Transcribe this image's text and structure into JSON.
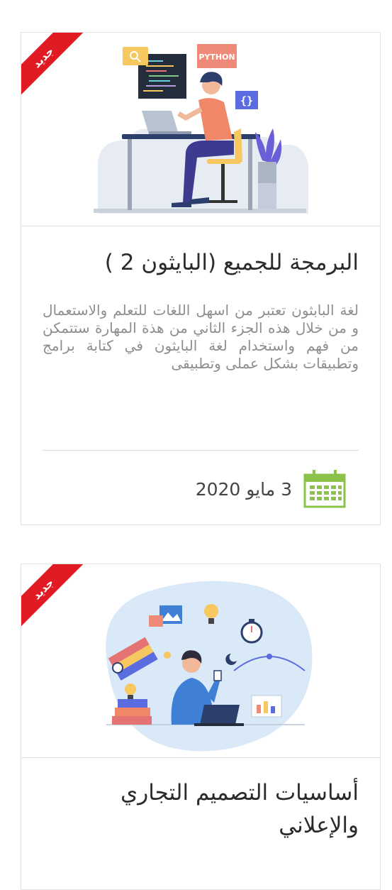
{
  "courses": [
    {
      "badge": "جديد",
      "title": "البرمجة للجميع (البايثون 2 )",
      "description": "لغة البابثون تعتبر من اسهل اللغات للتعلم والاستعمال و من خلال هذه الجزء الثاني من هذة المهارة ستتمكن من فهم واستخدام لغة البايثون في كتابة برامج وتطبيقات بشكل عملى وتطبيقى",
      "date": "3 مايو 2020",
      "image_labels": {
        "python_tag": "PYTHON",
        "braces": "{}"
      }
    },
    {
      "badge": "جديد",
      "title": "أساسيات التصميم التجاري والإعلاني"
    }
  ],
  "colors": {
    "ribbon": "#e01b24",
    "calendar": "#8bc34a",
    "title_text": "#2b2b2b",
    "description_text": "#8e8e8e"
  },
  "icons": {
    "calendar": "calendar-icon",
    "search_tag": "search-icon",
    "lightbulb": "lightbulb-icon",
    "stopwatch": "stopwatch-icon"
  }
}
